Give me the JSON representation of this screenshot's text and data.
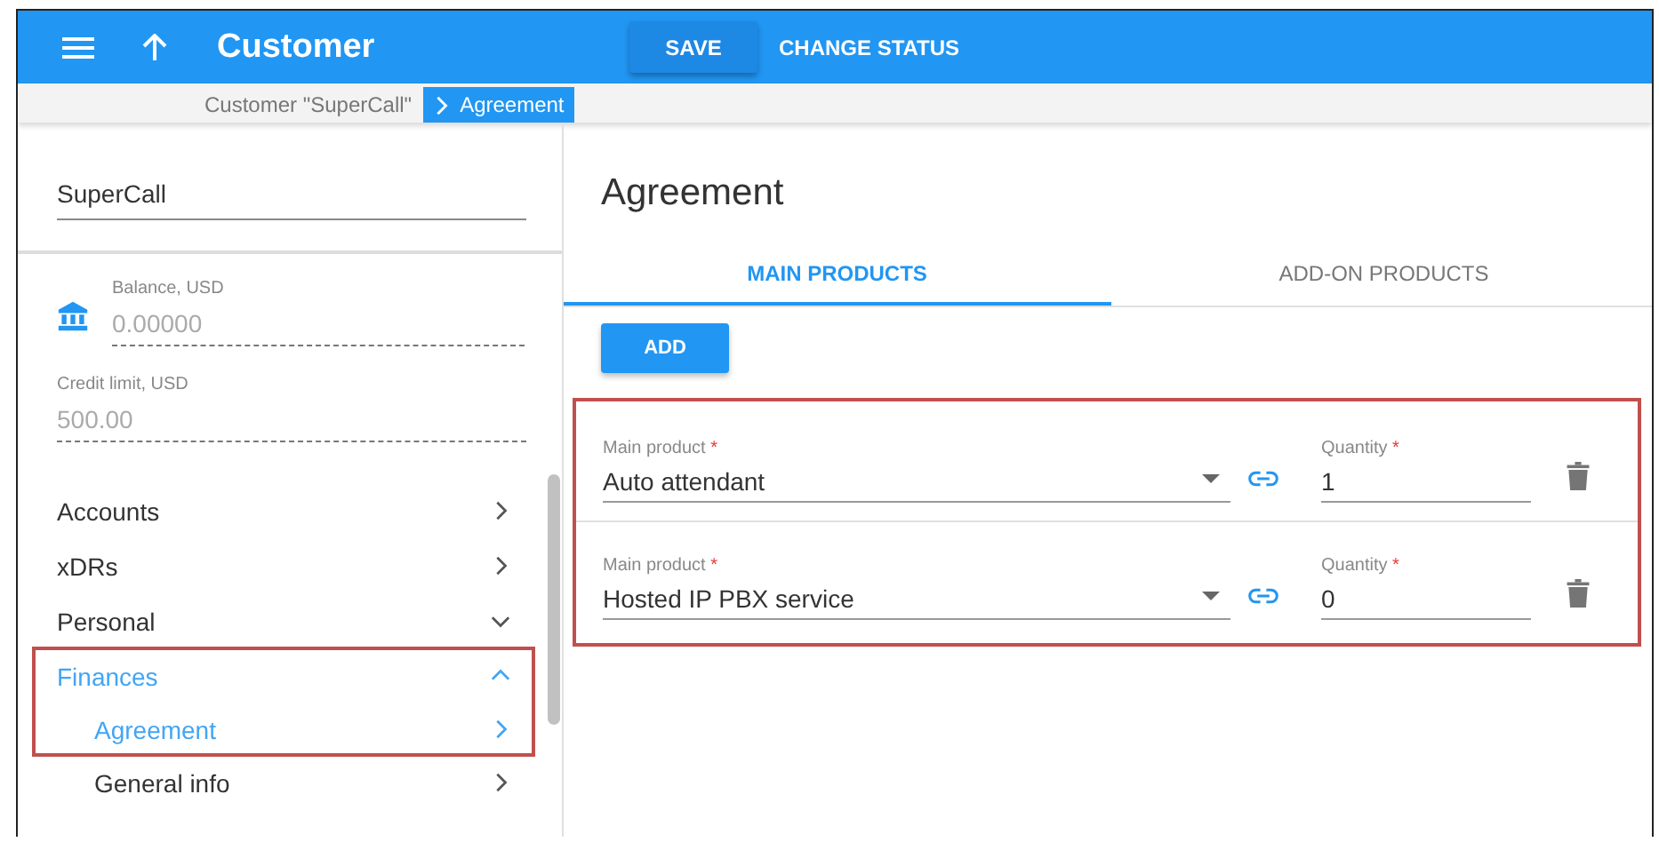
{
  "header": {
    "title": "Customer",
    "actions": [
      {
        "label": "SAVE",
        "kind": "raised"
      },
      {
        "label": "CHANGE STATUS",
        "kind": "flat"
      }
    ]
  },
  "breadcrumbs": [
    {
      "label": "Customer \"SuperCall\"",
      "selected": false
    },
    {
      "label": "Agreement",
      "selected": true
    }
  ],
  "sidebar": {
    "name": "SuperCall",
    "balance": {
      "label": "Balance, USD",
      "value": "0.00000"
    },
    "credit_limit": {
      "label": "Credit limit, USD",
      "value": "500.00"
    },
    "highlighted": true,
    "items": [
      {
        "kind": "link",
        "label": "Accounts",
        "selected": false
      },
      {
        "kind": "link",
        "label": "xDRs",
        "selected": false
      },
      {
        "kind": "group",
        "label": "Personal",
        "expanded": false,
        "selected": false
      },
      {
        "kind": "group",
        "label": "Finances",
        "expanded": true,
        "selected": true,
        "children": [
          {
            "label": "Agreement",
            "selected": true
          },
          {
            "label": "General info",
            "selected": false
          }
        ]
      }
    ]
  },
  "main": {
    "title": "Agreement",
    "tabs": [
      {
        "label": "MAIN PRODUCTS",
        "selected": true
      },
      {
        "label": "ADD-ON PRODUCTS",
        "selected": false
      }
    ],
    "add_button": "ADD",
    "highlighted": true,
    "products": [
      {
        "product_label": "Main product",
        "product_mark": "*",
        "product": "Auto attendant",
        "quantity_label": "Quantity",
        "quantity_mark": "*",
        "quantity": "1"
      },
      {
        "product_label": "Main product",
        "product_mark": "*",
        "product": "Hosted IP PBX service",
        "quantity_label": "Quantity",
        "quantity_mark": "*",
        "quantity": "0"
      }
    ]
  }
}
